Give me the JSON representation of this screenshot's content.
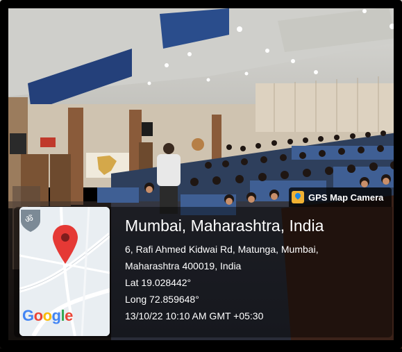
{
  "stamp": {
    "app_name": "GPS Map Camera",
    "place": "Mumbai, Maharashtra, India",
    "address_line1": "6, Rafi Ahmed Kidwai Rd, Matunga, Mumbai,",
    "address_line2": "Maharashtra 400019, India",
    "lat": "Lat 19.028442°",
    "long": "Long 72.859648°",
    "datetime": "13/10/22 10:10 AM GMT +05:30"
  },
  "map": {
    "logo_letters": [
      "G",
      "o",
      "o",
      "g",
      "l",
      "e"
    ],
    "pin_color": "#e53935",
    "map_bg": "#e9eef2"
  },
  "icons": {
    "badge": "map-pin-icon",
    "shield": "om-shield-icon"
  }
}
